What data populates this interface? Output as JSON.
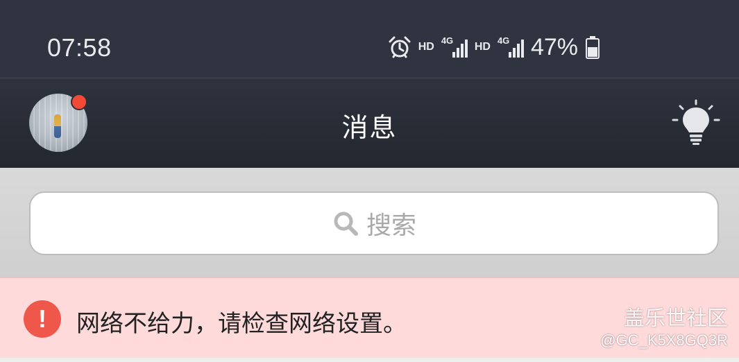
{
  "status_bar": {
    "time": "07:58",
    "alarm_icon": "alarm-clock-icon",
    "sim1": {
      "hd": "HD",
      "network": "4G"
    },
    "sim2": {
      "hd": "HD",
      "network": "4G"
    },
    "battery_percent": "47%",
    "battery_icon": "battery-icon"
  },
  "header": {
    "title": "消息",
    "avatar_icon": "profile-avatar",
    "notification_dot_color": "#f24a36",
    "right_icon": "lightbulb-icon"
  },
  "search": {
    "placeholder": "搜索",
    "icon": "search-icon"
  },
  "error_banner": {
    "icon": "exclamation-icon",
    "message": "网络不给力，请检查网络设置。",
    "background": "#ffdadb",
    "icon_color": "#f0574b"
  },
  "watermark": {
    "brand": "盖乐世社区",
    "user": "@GC_K5X8GQ3R"
  },
  "colors": {
    "header_bg": "#2a2e37",
    "status_bg": "#2f3440"
  }
}
